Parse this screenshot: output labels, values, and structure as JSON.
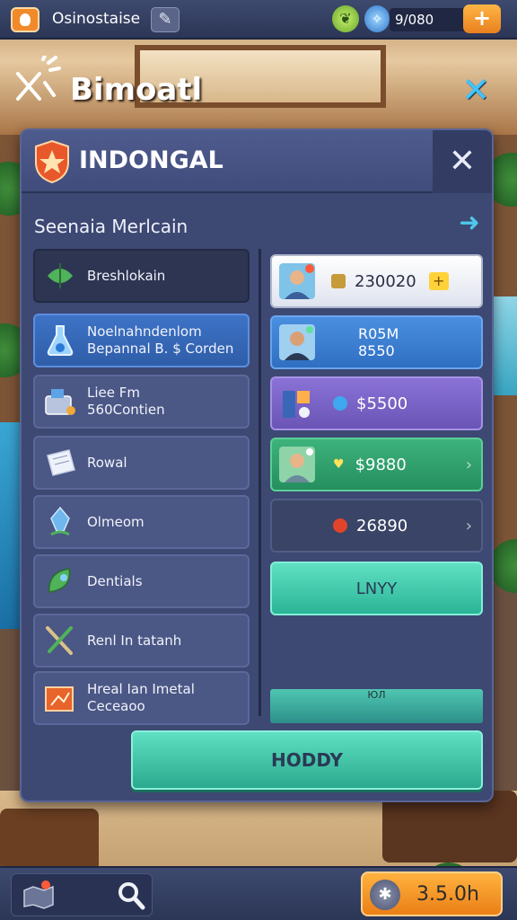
{
  "hud": {
    "title": "Osinostaise",
    "currency_value": "9/080",
    "icons": [
      "shield-logo-icon",
      "pencil-icon",
      "leaf-icon",
      "gem-icon",
      "plus-icon"
    ]
  },
  "location": {
    "title": "Bimoatl"
  },
  "panel": {
    "title": "INDONGAL",
    "section_label": "Seenaia Merlcain",
    "categories": [
      {
        "line1": "Breshlokain",
        "line2": "",
        "icon": "herb-icon",
        "style": "active"
      },
      {
        "line1": "Noelnahndenlom",
        "line2": "Bepannal B. $ Corden",
        "icon": "potion-icon",
        "style": "blue"
      },
      {
        "line1": "Liee Fm",
        "line2": "560Contien",
        "icon": "chest-icon",
        "style": "plain"
      },
      {
        "line1": "Rowal",
        "line2": "",
        "icon": "scroll-icon",
        "style": "plain"
      },
      {
        "line1": "Olmeom",
        "line2": "",
        "icon": "crystal-icon",
        "style": "plain"
      },
      {
        "line1": "Dentials",
        "line2": "",
        "icon": "leaf-icon",
        "style": "plain"
      },
      {
        "line1": "Renl In tatanh",
        "line2": "",
        "icon": "tools-icon",
        "style": "plain"
      },
      {
        "line1": "Hreal Ian Imetal",
        "line2": "Ceceaoo",
        "icon": "map-frame-icon",
        "style": "plain"
      }
    ],
    "offers": [
      {
        "value": "230020",
        "value2": "",
        "style": "white",
        "icon": "coin-icon"
      },
      {
        "value": "R05M",
        "value2": "8550",
        "style": "blue",
        "icon": ""
      },
      {
        "value": "$5500",
        "value2": "",
        "style": "purple",
        "icon": "dot-icon"
      },
      {
        "value": "$9880",
        "value2": "",
        "style": "green",
        "icon": "heart-icon"
      },
      {
        "value": "26890",
        "value2": "",
        "style": "dark",
        "icon": "ruby-icon"
      }
    ],
    "cta_label": "LNYY",
    "strip_label": "ЮЛ",
    "main_button_label": "HODDY"
  },
  "bottom": {
    "time_label": "3.5.0h"
  },
  "colors": {
    "accent_orange": "#f08a2a",
    "accent_teal": "#3fc4ff",
    "panel_bg": "#3d4873"
  }
}
